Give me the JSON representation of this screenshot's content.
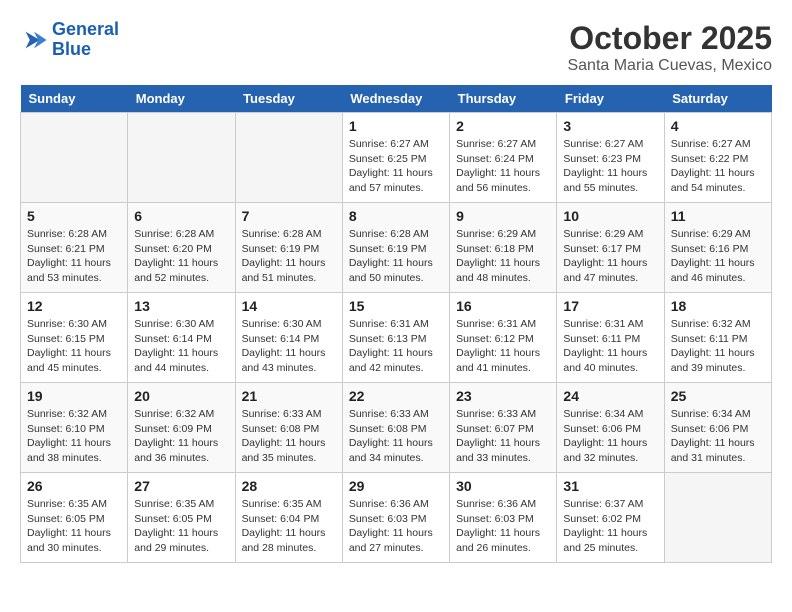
{
  "header": {
    "logo_line1": "General",
    "logo_line2": "Blue",
    "month": "October 2025",
    "location": "Santa Maria Cuevas, Mexico"
  },
  "days_of_week": [
    "Sunday",
    "Monday",
    "Tuesday",
    "Wednesday",
    "Thursday",
    "Friday",
    "Saturday"
  ],
  "weeks": [
    [
      {
        "day": "",
        "info": ""
      },
      {
        "day": "",
        "info": ""
      },
      {
        "day": "",
        "info": ""
      },
      {
        "day": "1",
        "info": "Sunrise: 6:27 AM\nSunset: 6:25 PM\nDaylight: 11 hours\nand 57 minutes."
      },
      {
        "day": "2",
        "info": "Sunrise: 6:27 AM\nSunset: 6:24 PM\nDaylight: 11 hours\nand 56 minutes."
      },
      {
        "day": "3",
        "info": "Sunrise: 6:27 AM\nSunset: 6:23 PM\nDaylight: 11 hours\nand 55 minutes."
      },
      {
        "day": "4",
        "info": "Sunrise: 6:27 AM\nSunset: 6:22 PM\nDaylight: 11 hours\nand 54 minutes."
      }
    ],
    [
      {
        "day": "5",
        "info": "Sunrise: 6:28 AM\nSunset: 6:21 PM\nDaylight: 11 hours\nand 53 minutes."
      },
      {
        "day": "6",
        "info": "Sunrise: 6:28 AM\nSunset: 6:20 PM\nDaylight: 11 hours\nand 52 minutes."
      },
      {
        "day": "7",
        "info": "Sunrise: 6:28 AM\nSunset: 6:19 PM\nDaylight: 11 hours\nand 51 minutes."
      },
      {
        "day": "8",
        "info": "Sunrise: 6:28 AM\nSunset: 6:19 PM\nDaylight: 11 hours\nand 50 minutes."
      },
      {
        "day": "9",
        "info": "Sunrise: 6:29 AM\nSunset: 6:18 PM\nDaylight: 11 hours\nand 48 minutes."
      },
      {
        "day": "10",
        "info": "Sunrise: 6:29 AM\nSunset: 6:17 PM\nDaylight: 11 hours\nand 47 minutes."
      },
      {
        "day": "11",
        "info": "Sunrise: 6:29 AM\nSunset: 6:16 PM\nDaylight: 11 hours\nand 46 minutes."
      }
    ],
    [
      {
        "day": "12",
        "info": "Sunrise: 6:30 AM\nSunset: 6:15 PM\nDaylight: 11 hours\nand 45 minutes."
      },
      {
        "day": "13",
        "info": "Sunrise: 6:30 AM\nSunset: 6:14 PM\nDaylight: 11 hours\nand 44 minutes."
      },
      {
        "day": "14",
        "info": "Sunrise: 6:30 AM\nSunset: 6:14 PM\nDaylight: 11 hours\nand 43 minutes."
      },
      {
        "day": "15",
        "info": "Sunrise: 6:31 AM\nSunset: 6:13 PM\nDaylight: 11 hours\nand 42 minutes."
      },
      {
        "day": "16",
        "info": "Sunrise: 6:31 AM\nSunset: 6:12 PM\nDaylight: 11 hours\nand 41 minutes."
      },
      {
        "day": "17",
        "info": "Sunrise: 6:31 AM\nSunset: 6:11 PM\nDaylight: 11 hours\nand 40 minutes."
      },
      {
        "day": "18",
        "info": "Sunrise: 6:32 AM\nSunset: 6:11 PM\nDaylight: 11 hours\nand 39 minutes."
      }
    ],
    [
      {
        "day": "19",
        "info": "Sunrise: 6:32 AM\nSunset: 6:10 PM\nDaylight: 11 hours\nand 38 minutes."
      },
      {
        "day": "20",
        "info": "Sunrise: 6:32 AM\nSunset: 6:09 PM\nDaylight: 11 hours\nand 36 minutes."
      },
      {
        "day": "21",
        "info": "Sunrise: 6:33 AM\nSunset: 6:08 PM\nDaylight: 11 hours\nand 35 minutes."
      },
      {
        "day": "22",
        "info": "Sunrise: 6:33 AM\nSunset: 6:08 PM\nDaylight: 11 hours\nand 34 minutes."
      },
      {
        "day": "23",
        "info": "Sunrise: 6:33 AM\nSunset: 6:07 PM\nDaylight: 11 hours\nand 33 minutes."
      },
      {
        "day": "24",
        "info": "Sunrise: 6:34 AM\nSunset: 6:06 PM\nDaylight: 11 hours\nand 32 minutes."
      },
      {
        "day": "25",
        "info": "Sunrise: 6:34 AM\nSunset: 6:06 PM\nDaylight: 11 hours\nand 31 minutes."
      }
    ],
    [
      {
        "day": "26",
        "info": "Sunrise: 6:35 AM\nSunset: 6:05 PM\nDaylight: 11 hours\nand 30 minutes."
      },
      {
        "day": "27",
        "info": "Sunrise: 6:35 AM\nSunset: 6:05 PM\nDaylight: 11 hours\nand 29 minutes."
      },
      {
        "day": "28",
        "info": "Sunrise: 6:35 AM\nSunset: 6:04 PM\nDaylight: 11 hours\nand 28 minutes."
      },
      {
        "day": "29",
        "info": "Sunrise: 6:36 AM\nSunset: 6:03 PM\nDaylight: 11 hours\nand 27 minutes."
      },
      {
        "day": "30",
        "info": "Sunrise: 6:36 AM\nSunset: 6:03 PM\nDaylight: 11 hours\nand 26 minutes."
      },
      {
        "day": "31",
        "info": "Sunrise: 6:37 AM\nSunset: 6:02 PM\nDaylight: 11 hours\nand 25 minutes."
      },
      {
        "day": "",
        "info": ""
      }
    ]
  ]
}
